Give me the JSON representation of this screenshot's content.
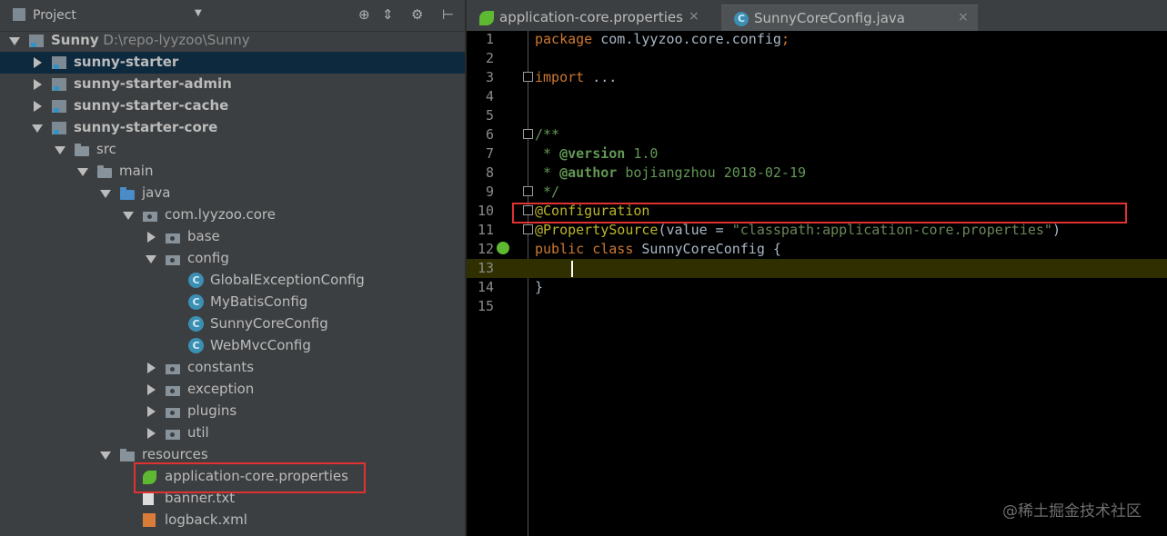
{
  "project_panel": {
    "title": "Project",
    "toolbar": [
      "target-icon",
      "collapse-icon",
      "gear-icon",
      "hide-icon"
    ],
    "tree": [
      {
        "label": "Sunny",
        "extra": "D:\\repo-lyyzoo\\Sunny",
        "icon": "module-icon",
        "expanded": true,
        "bold": true
      },
      {
        "label": "sunny-starter",
        "icon": "module-icon",
        "expanded": false,
        "bold": true,
        "selected": true
      },
      {
        "label": "sunny-starter-admin",
        "icon": "module-icon",
        "expanded": false,
        "bold": true
      },
      {
        "label": "sunny-starter-cache",
        "icon": "module-icon",
        "expanded": false,
        "bold": true
      },
      {
        "label": "sunny-starter-core",
        "icon": "module-icon",
        "expanded": true,
        "bold": true
      },
      {
        "label": "src",
        "icon": "folder-icon",
        "expanded": true
      },
      {
        "label": "main",
        "icon": "folder-icon",
        "expanded": true
      },
      {
        "label": "java",
        "icon": "source-folder-icon",
        "expanded": true
      },
      {
        "label": "com.lyyzoo.core",
        "icon": "package-icon",
        "expanded": true
      },
      {
        "label": "base",
        "icon": "package-icon",
        "expanded": false
      },
      {
        "label": "config",
        "icon": "package-icon",
        "expanded": true
      },
      {
        "label": "GlobalExceptionConfig",
        "icon": "class-icon"
      },
      {
        "label": "MyBatisConfig",
        "icon": "class-icon"
      },
      {
        "label": "SunnyCoreConfig",
        "icon": "class-icon"
      },
      {
        "label": "WebMvcConfig",
        "icon": "class-icon"
      },
      {
        "label": "constants",
        "icon": "package-icon",
        "expanded": false
      },
      {
        "label": "exception",
        "icon": "package-icon",
        "expanded": false
      },
      {
        "label": "plugins",
        "icon": "package-icon",
        "expanded": false
      },
      {
        "label": "util",
        "icon": "package-icon",
        "expanded": false
      },
      {
        "label": "resources",
        "icon": "resources-folder-icon",
        "expanded": true
      },
      {
        "label": "application-core.properties",
        "icon": "spring-properties-icon"
      },
      {
        "label": "banner.txt",
        "icon": "text-file-icon"
      },
      {
        "label": "logback.xml",
        "icon": "xml-file-icon"
      }
    ]
  },
  "editor": {
    "tabs": [
      {
        "label": "application-core.properties",
        "icon": "spring-properties-icon",
        "active": false,
        "close": "×"
      },
      {
        "label": "SunnyCoreConfig.java",
        "icon": "class-icon",
        "active": true,
        "close": "×"
      }
    ],
    "lines": [
      {
        "n": "1",
        "tokens": [
          {
            "t": "package ",
            "c": "kw"
          },
          {
            "t": "com.lyyzoo.core.config",
            "c": ""
          },
          {
            "t": ";",
            "c": "kw"
          }
        ]
      },
      {
        "n": "2",
        "tokens": []
      },
      {
        "n": "3",
        "tokens": [
          {
            "t": "import ",
            "c": "kw"
          },
          {
            "t": "...",
            "c": ""
          }
        ]
      },
      {
        "n": "4",
        "tokens": []
      },
      {
        "n": "5",
        "tokens": []
      },
      {
        "n": "6",
        "tokens": [
          {
            "t": "/**",
            "c": "cm"
          }
        ]
      },
      {
        "n": "7",
        "tokens": [
          {
            "t": " * ",
            "c": "cm"
          },
          {
            "t": "@version",
            "c": "cmtag"
          },
          {
            "t": " 1.0",
            "c": "cm"
          }
        ]
      },
      {
        "n": "8",
        "tokens": [
          {
            "t": " * ",
            "c": "cm"
          },
          {
            "t": "@author",
            "c": "cmtag"
          },
          {
            "t": " bojiangzhou 2018-02-19",
            "c": "cm"
          }
        ]
      },
      {
        "n": "9",
        "tokens": [
          {
            "t": " */",
            "c": "cm"
          }
        ]
      },
      {
        "n": "10",
        "tokens": [
          {
            "t": "@Configuration",
            "c": "ann"
          }
        ]
      },
      {
        "n": "11",
        "tokens": [
          {
            "t": "@PropertySource",
            "c": "ann"
          },
          {
            "t": "(value = ",
            "c": ""
          },
          {
            "t": "\"classpath:application-core.properties\"",
            "c": "str"
          },
          {
            "t": ")",
            "c": ""
          }
        ]
      },
      {
        "n": "12",
        "tokens": [
          {
            "t": "public class ",
            "c": "kw"
          },
          {
            "t": "SunnyCoreConfig {",
            "c": ""
          }
        ]
      },
      {
        "n": "13",
        "tokens": []
      },
      {
        "n": "14",
        "tokens": [
          {
            "t": "}",
            "c": ""
          }
        ]
      },
      {
        "n": "15",
        "tokens": []
      }
    ],
    "current_line": "13"
  },
  "watermark": "@稀土掘金技术社区",
  "colors": {
    "panel_bg": "#3c3f41",
    "selection": "#0d293e",
    "editor_bg": "#000000",
    "highlight_box": "#e03131"
  }
}
